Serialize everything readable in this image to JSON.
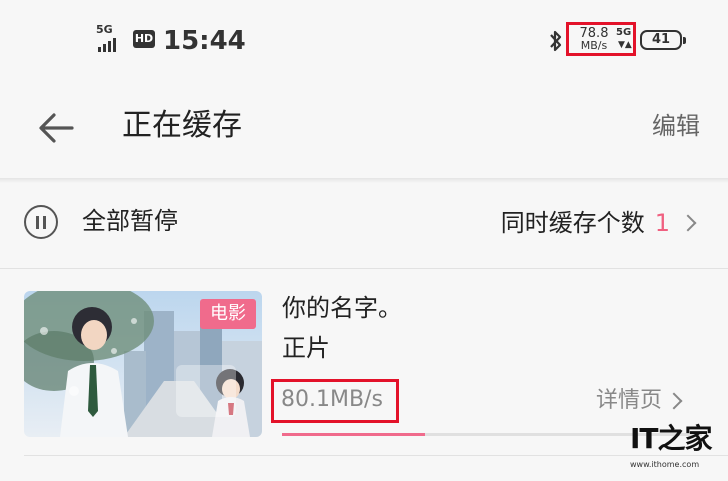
{
  "status_bar": {
    "network_type": "5G",
    "hd_label": "HD",
    "time": "15:44",
    "net_speed": "78.8",
    "net_speed_unit": "MB/s",
    "network_type_right": "5G",
    "battery": "41"
  },
  "header": {
    "title": "正在缓存",
    "edit_label": "编辑"
  },
  "controls": {
    "pause_all_label": "全部暂停",
    "concurrent_label": "同时缓存个数",
    "concurrent_count": "1"
  },
  "download_items": [
    {
      "badge": "电影",
      "title": "你的名字。",
      "subtitle": "正片",
      "speed": "80.1MB/s",
      "details_label": "详情页",
      "progress_fraction": 0.34
    }
  ],
  "watermark": {
    "url": "www.ithome.com"
  },
  "colors": {
    "accent": "#f06b8c",
    "highlight_box": "#e3122a",
    "background": "#f7f7f7"
  },
  "icons": [
    "signal-icon",
    "bluetooth-icon",
    "battery-icon",
    "back-arrow-icon",
    "pause-circle-icon",
    "chevron-right-icon"
  ]
}
